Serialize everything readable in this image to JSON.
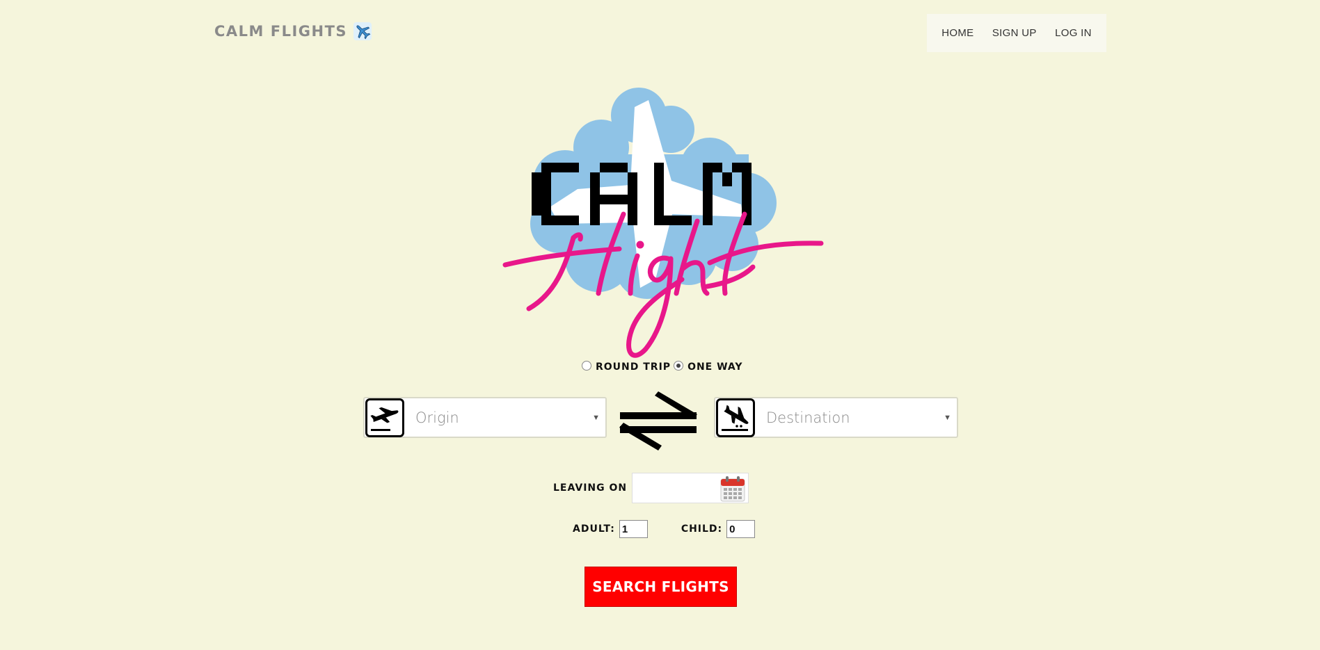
{
  "header": {
    "brand_name": "CALM FLIGHTS",
    "brand_icon": "airplane-icon"
  },
  "nav": {
    "items": [
      {
        "label": "HOME"
      },
      {
        "label": "SIGN UP"
      },
      {
        "label": "LOG IN"
      }
    ]
  },
  "logo": {
    "word_top": "CALM",
    "word_bottom": "flight",
    "cloud_color": "#8fc3e6",
    "script_color": "#e8178a"
  },
  "trip_type": {
    "options": [
      {
        "label": "ROUND TRIP",
        "checked": false
      },
      {
        "label": "ONE WAY",
        "checked": true
      }
    ]
  },
  "origin": {
    "placeholder": "Origin",
    "icon": "departures-icon"
  },
  "swap": {
    "icon": "swap-arrows-icon"
  },
  "destination": {
    "placeholder": "Destination",
    "icon": "arrivals-icon"
  },
  "leaving": {
    "label": "LEAVING ON",
    "value": "",
    "icon": "calendar-icon"
  },
  "passengers": {
    "adult_label": "ADULT:",
    "adult_value": "1",
    "child_label": "CHILD:",
    "child_value": "0"
  },
  "search": {
    "label": "SEARCH FLIGHTS",
    "color": "#ff0000"
  },
  "colors": {
    "background": "#f5f5dc",
    "brand_text": "#8a8a8a"
  }
}
